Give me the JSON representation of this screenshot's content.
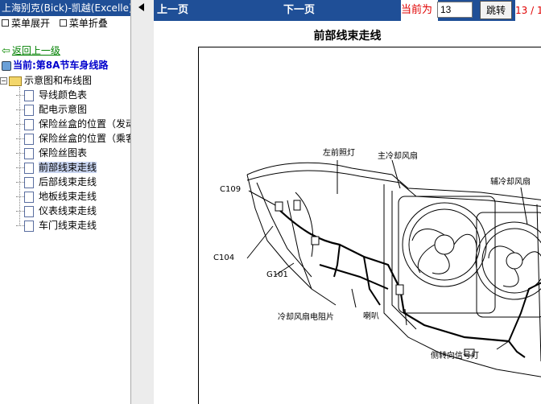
{
  "sidebar": {
    "title": "上海别克(Bick)-凯越(Excelle)",
    "menu_expand": "菜单展开",
    "menu_collapse": "菜单折叠",
    "back_link": "返回上一级",
    "current": "当前:第8A节车身线路",
    "folder": "示意图和布线图",
    "items": [
      {
        "label": "导线颜色表"
      },
      {
        "label": "配电示意图"
      },
      {
        "label": "保险丝盒的位置（发动"
      },
      {
        "label": "保险丝盒的位置（乘客"
      },
      {
        "label": "保险丝图表"
      },
      {
        "label": "前部线束走线"
      },
      {
        "label": "后部线束走线"
      },
      {
        "label": "地板线束走线"
      },
      {
        "label": "仪表线束走线"
      },
      {
        "label": "车门线束走线"
      }
    ]
  },
  "toolbar": {
    "prev": "上一页",
    "next": "下一页",
    "current_label": "当前为",
    "page_value": "13",
    "go_label": "跳转",
    "page_count": "13 / 1"
  },
  "document": {
    "title": "前部线束走线",
    "labels": {
      "front_left_light": "左前照灯",
      "main_fan": "主冷却风扇",
      "aux_fan": "辅冷却风扇",
      "c109": "C109",
      "c104": "C104",
      "g101": "G101",
      "fan_resistor": "冷却风扇电阻片",
      "horn": "喇叭",
      "side_signal": "侧转向信号灯"
    }
  },
  "colors": {
    "title_bar": "#1f4f97",
    "accent_red": "#e00000",
    "link_green": "#008000",
    "current_blue": "#0000cc"
  }
}
